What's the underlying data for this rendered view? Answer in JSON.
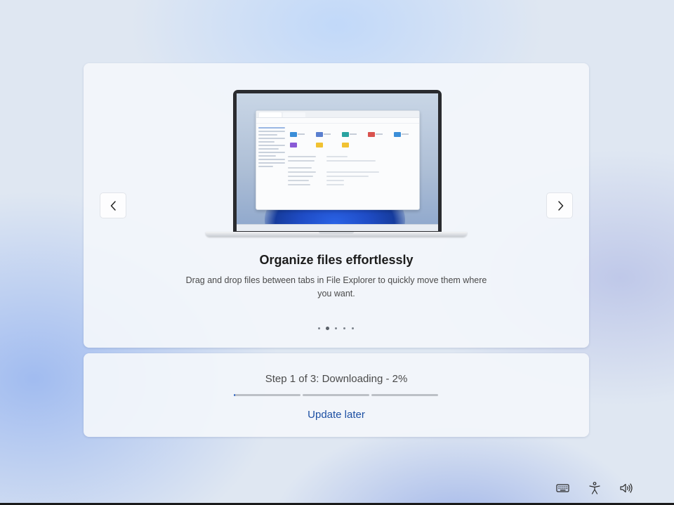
{
  "slide": {
    "title": "Organize files effortlessly",
    "description": "Drag and drop files between tabs in File Explorer to quickly move them where you want.",
    "total_slides": 5,
    "current_index": 1,
    "prev_icon": "chevron-left-icon",
    "next_icon": "chevron-right-icon",
    "illustration": "laptop-file-explorer"
  },
  "status": {
    "step_text": "Step 1 of 3: Downloading - 2%",
    "progress_segments": 3,
    "current_step": 1,
    "percent_complete": 2,
    "accent_color": "#2a63c7"
  },
  "actions": {
    "update_later": "Update later"
  },
  "system_tray": {
    "icons": [
      "keyboard-icon",
      "accessibility-icon",
      "volume-icon"
    ]
  }
}
